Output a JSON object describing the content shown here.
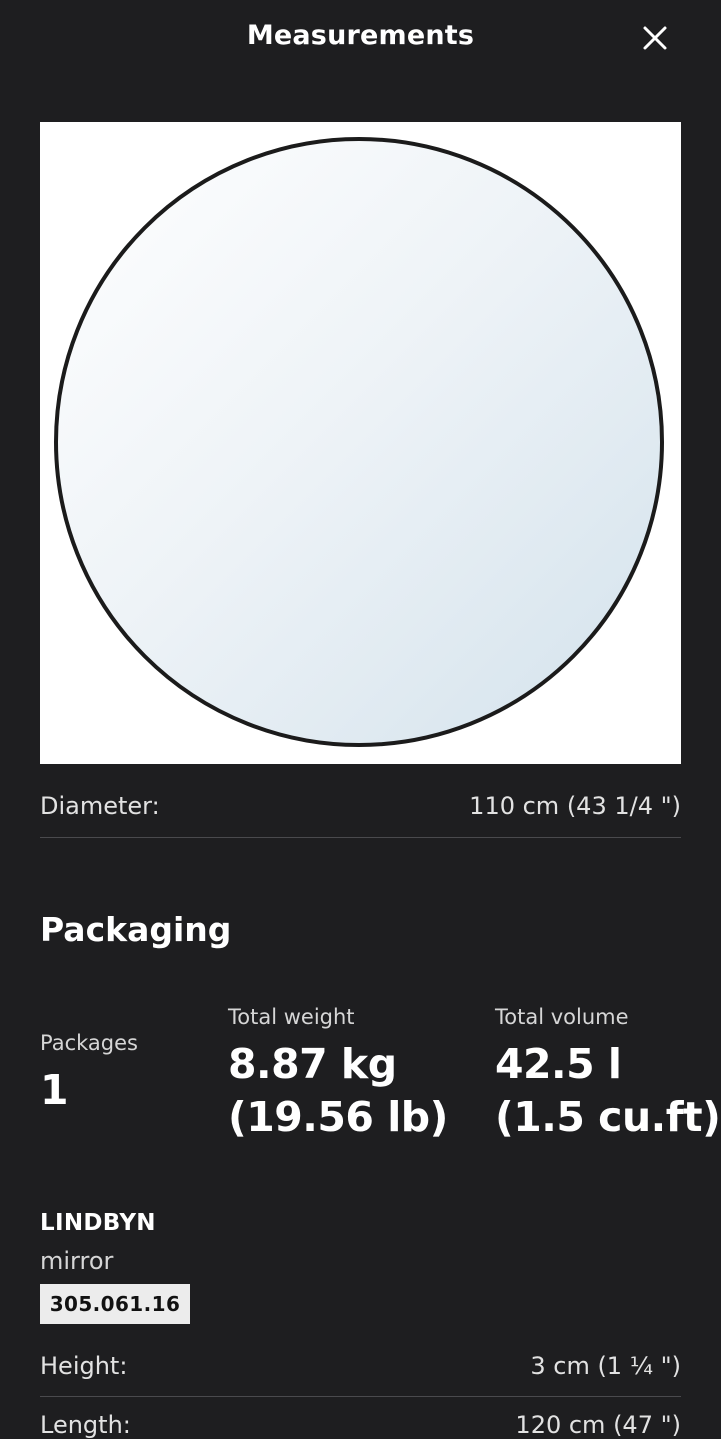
{
  "header": {
    "title": "Measurements",
    "close_icon": "close-icon"
  },
  "illustration": {
    "subject": "round-mirror",
    "colors": {
      "frame": "#1b1b1b",
      "glass_light": "#f8fafc",
      "glass_dark": "#d6e4ee",
      "background": "#ffffff"
    }
  },
  "dimensions": {
    "diameter_label": "Diameter:",
    "diameter_value": "110 cm (43 1/4 \")"
  },
  "packaging": {
    "title": "Packaging",
    "packages_label": "Packages",
    "packages_value": "1",
    "weight_label": "Total weight",
    "weight_line1": "8.87 kg",
    "weight_line2": "(19.56 lb)",
    "volume_label": "Total volume",
    "volume_line1": "42.5 l",
    "volume_line2": "(1.5 cu.ft)"
  },
  "product": {
    "name": "LINDBYN",
    "type": "mirror",
    "article_number": "305.061.16",
    "height_label": "Height:",
    "height_value": "3 cm (1 ¼ \")",
    "length_label": "Length:",
    "length_value": "120 cm (47 \")"
  },
  "colors": {
    "background": "#1e1e20",
    "text_primary": "#ffffff",
    "text_secondary": "#d6d6d6",
    "divider": "#4a4a4d",
    "badge_bg": "#ececec"
  }
}
